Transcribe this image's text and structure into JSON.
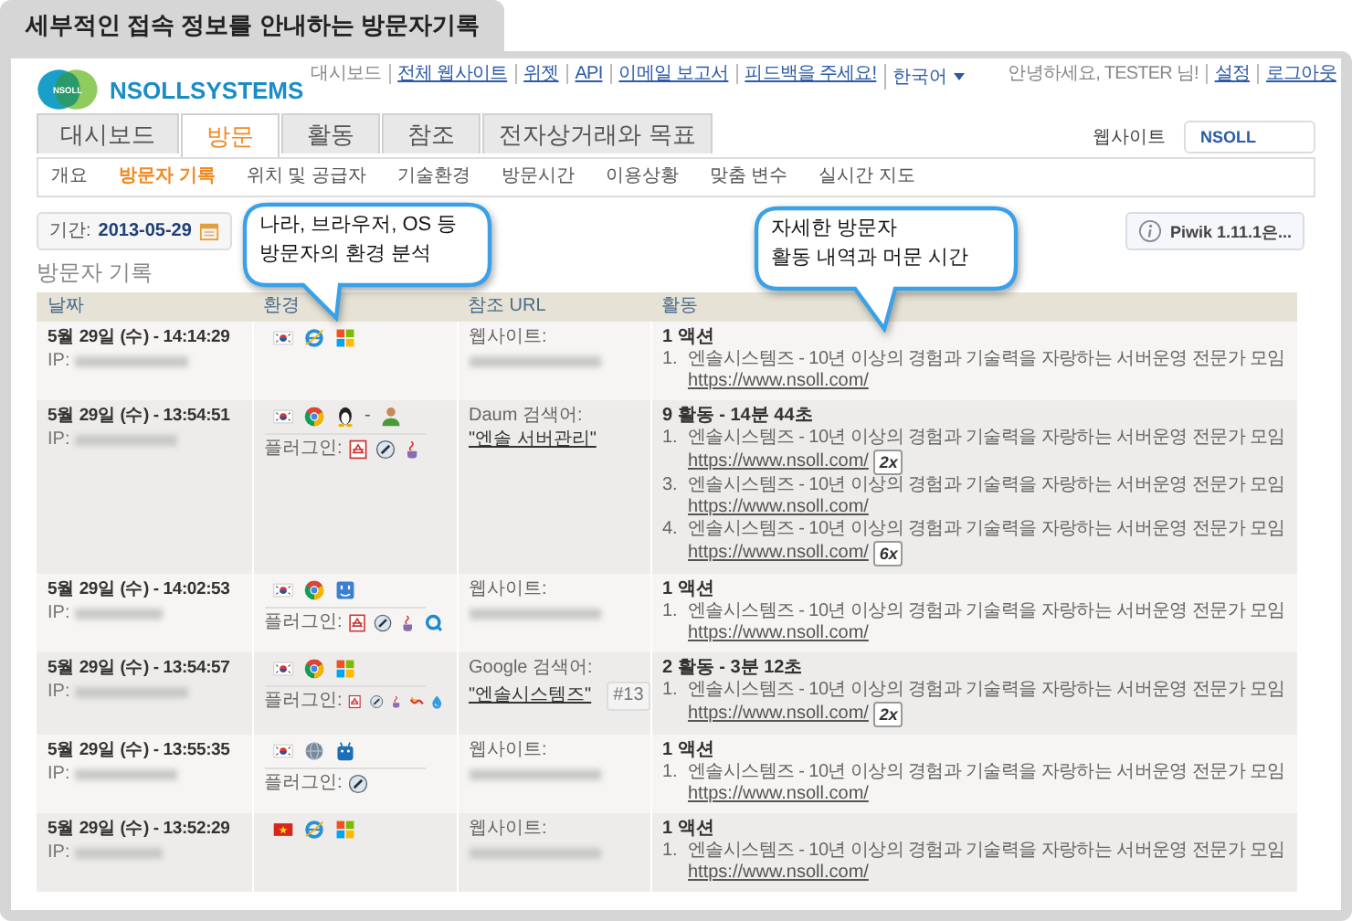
{
  "title_tab": "세부적인 접속 정보를 안내하는 방문자기록",
  "logo": {
    "mark": "NSOLL",
    "name": "NSOLLSYSTEMS"
  },
  "top_links": [
    {
      "kind": "plain",
      "text": "대시보드"
    },
    {
      "kind": "link",
      "text": "전체 웹사이트"
    },
    {
      "kind": "link",
      "text": "위젯"
    },
    {
      "kind": "link",
      "text": "API"
    },
    {
      "kind": "link",
      "text": "이메일 보고서"
    },
    {
      "kind": "link",
      "text": "피드백을 주세요!"
    },
    {
      "kind": "dropdown",
      "text": "한국어"
    }
  ],
  "user_links": [
    {
      "kind": "plain",
      "text": "안녕하세요, TESTER 님!"
    },
    {
      "kind": "link",
      "text": "설정"
    },
    {
      "kind": "link",
      "text": "로그아웃"
    }
  ],
  "tabs": [
    {
      "label": "대시보드",
      "selected": false
    },
    {
      "label": "방문",
      "selected": true
    },
    {
      "label": "활동",
      "selected": false
    },
    {
      "label": "참조",
      "selected": false
    },
    {
      "label": "전자상거래와 목표",
      "selected": false
    }
  ],
  "website_selector": {
    "label": "웹사이트",
    "value": "NSOLL"
  },
  "subnav": [
    {
      "label": "개요",
      "selected": false
    },
    {
      "label": "방문자 기록",
      "selected": true
    },
    {
      "label": "위치 및 공급자",
      "selected": false
    },
    {
      "label": "기술환경",
      "selected": false
    },
    {
      "label": "방문시간",
      "selected": false
    },
    {
      "label": "이용상황",
      "selected": false
    },
    {
      "label": "맞춤 변수",
      "selected": false
    },
    {
      "label": "실시간 지도",
      "selected": false
    }
  ],
  "period": {
    "label": "기간:",
    "value": "2013-05-29"
  },
  "notice": "Piwik 1.11.1은...",
  "section_title": "방문자 기록",
  "columns": [
    "날짜",
    "환경",
    "참조 URL",
    "활동"
  ],
  "rows": [
    {
      "date": "5월 29일 (수) - 14:14:29",
      "ip_label": "IP:",
      "env": [
        {
          "kind": "kr"
        },
        {
          "kind": "ie"
        },
        {
          "kind": "windows"
        }
      ],
      "referrer": {
        "kind": "website",
        "label": "웹사이트:"
      },
      "activity": {
        "summary": "1 액션",
        "actions": [
          {
            "num": "1.",
            "title": "엔솔시스템즈 - 10년 이상의 경험과 기술력을 자랑하는 서버운영 전문가 모임",
            "url": "https://www.nsoll.com/"
          }
        ]
      }
    },
    {
      "date": "5월 29일 (수) - 13:54:51",
      "ip_label": "IP:",
      "env": [
        {
          "kind": "kr"
        },
        {
          "kind": "chrome"
        },
        {
          "kind": "linux"
        },
        {
          "kind": "dash",
          "text": "-"
        },
        {
          "kind": "user"
        }
      ],
      "plugins": {
        "label": "플러그인:",
        "items": [
          {
            "kind": "pdf"
          },
          {
            "kind": "flash"
          },
          {
            "kind": "java"
          }
        ]
      },
      "referrer": {
        "kind": "search",
        "label": "Daum 검색어:",
        "keyword": "\"엔솔 서버관리\""
      },
      "activity": {
        "summary": "9 활동 - 14분 44초",
        "actions": [
          {
            "num": "1.",
            "title": "엔솔시스템즈 - 10년 이상의 경험과 기술력을 자랑하는 서버운영 전문가 모임",
            "url": "https://www.nsoll.com/",
            "count": "2x"
          },
          {
            "num": "3.",
            "title": "엔솔시스템즈 - 10년 이상의 경험과 기술력을 자랑하는 서버운영 전문가 모임",
            "url": "https://www.nsoll.com/"
          },
          {
            "num": "4.",
            "title": "엔솔시스템즈 - 10년 이상의 경험과 기술력을 자랑하는 서버운영 전문가 모임",
            "url": "https://www.nsoll.com/",
            "count": "6x"
          }
        ]
      }
    },
    {
      "date": "5월 29일 (수) - 14:02:53",
      "ip_label": "IP:",
      "env": [
        {
          "kind": "kr"
        },
        {
          "kind": "chrome"
        },
        {
          "kind": "mac"
        }
      ],
      "plugins": {
        "label": "플러그인:",
        "items": [
          {
            "kind": "pdf"
          },
          {
            "kind": "flash"
          },
          {
            "kind": "java"
          },
          {
            "kind": "quicktime"
          }
        ]
      },
      "referrer": {
        "kind": "website",
        "label": "웹사이트:"
      },
      "activity": {
        "summary": "1 액션",
        "actions": [
          {
            "num": "1.",
            "title": "엔솔시스템즈 - 10년 이상의 경험과 기술력을 자랑하는 서버운영 전문가 모임",
            "url": "https://www.nsoll.com/"
          }
        ]
      }
    },
    {
      "date": "5월 29일 (수) - 13:54:57",
      "ip_label": "IP:",
      "env": [
        {
          "kind": "kr"
        },
        {
          "kind": "chrome"
        },
        {
          "kind": "windows"
        }
      ],
      "plugins": {
        "label": "플러그인:",
        "items": [
          {
            "kind": "pdf"
          },
          {
            "kind": "flash"
          },
          {
            "kind": "java"
          },
          {
            "kind": "realplayer"
          },
          {
            "kind": "silverlight"
          }
        ]
      },
      "referrer": {
        "kind": "search",
        "label": "Google 검색어:",
        "keyword": "\"엔솔시스템즈\"",
        "rank": "#13"
      },
      "activity": {
        "summary": "2 활동 - 3분 12초",
        "actions": [
          {
            "num": "1.",
            "title": "엔솔시스템즈 - 10년 이상의 경험과 기술력을 자랑하는 서버운영 전문가 모임",
            "url": "https://www.nsoll.com/",
            "count": "2x"
          }
        ]
      }
    },
    {
      "date": "5월 29일 (수) - 13:55:35",
      "ip_label": "IP:",
      "env": [
        {
          "kind": "kr"
        },
        {
          "kind": "globe"
        },
        {
          "kind": "android"
        }
      ],
      "plugins": {
        "label": "플러그인:",
        "items": [
          {
            "kind": "flash"
          }
        ]
      },
      "referrer": {
        "kind": "website",
        "label": "웹사이트:"
      },
      "activity": {
        "summary": "1 액션",
        "actions": [
          {
            "num": "1.",
            "title": "엔솔시스템즈 - 10년 이상의 경험과 기술력을 자랑하는 서버운영 전문가 모임",
            "url": "https://www.nsoll.com/"
          }
        ]
      }
    },
    {
      "date": "5월 29일 (수) - 13:52:29",
      "ip_label": "IP:",
      "env": [
        {
          "kind": "vn"
        },
        {
          "kind": "ie"
        },
        {
          "kind": "windows"
        }
      ],
      "referrer": {
        "kind": "website",
        "label": "웹사이트:"
      },
      "activity": {
        "summary": "1 액션",
        "actions": [
          {
            "num": "1.",
            "title": "엔솔시스템즈 - 10년 이상의 경험과 기술력을 자랑하는 서버운영 전문가 모임",
            "url": "https://www.nsoll.com/"
          }
        ]
      }
    }
  ],
  "callouts": [
    {
      "text": "나라, 브라우저, OS 등\n방문자의 환경 분석"
    },
    {
      "text": "자세한 방문자\n활동 내역과 머문 시간"
    }
  ]
}
